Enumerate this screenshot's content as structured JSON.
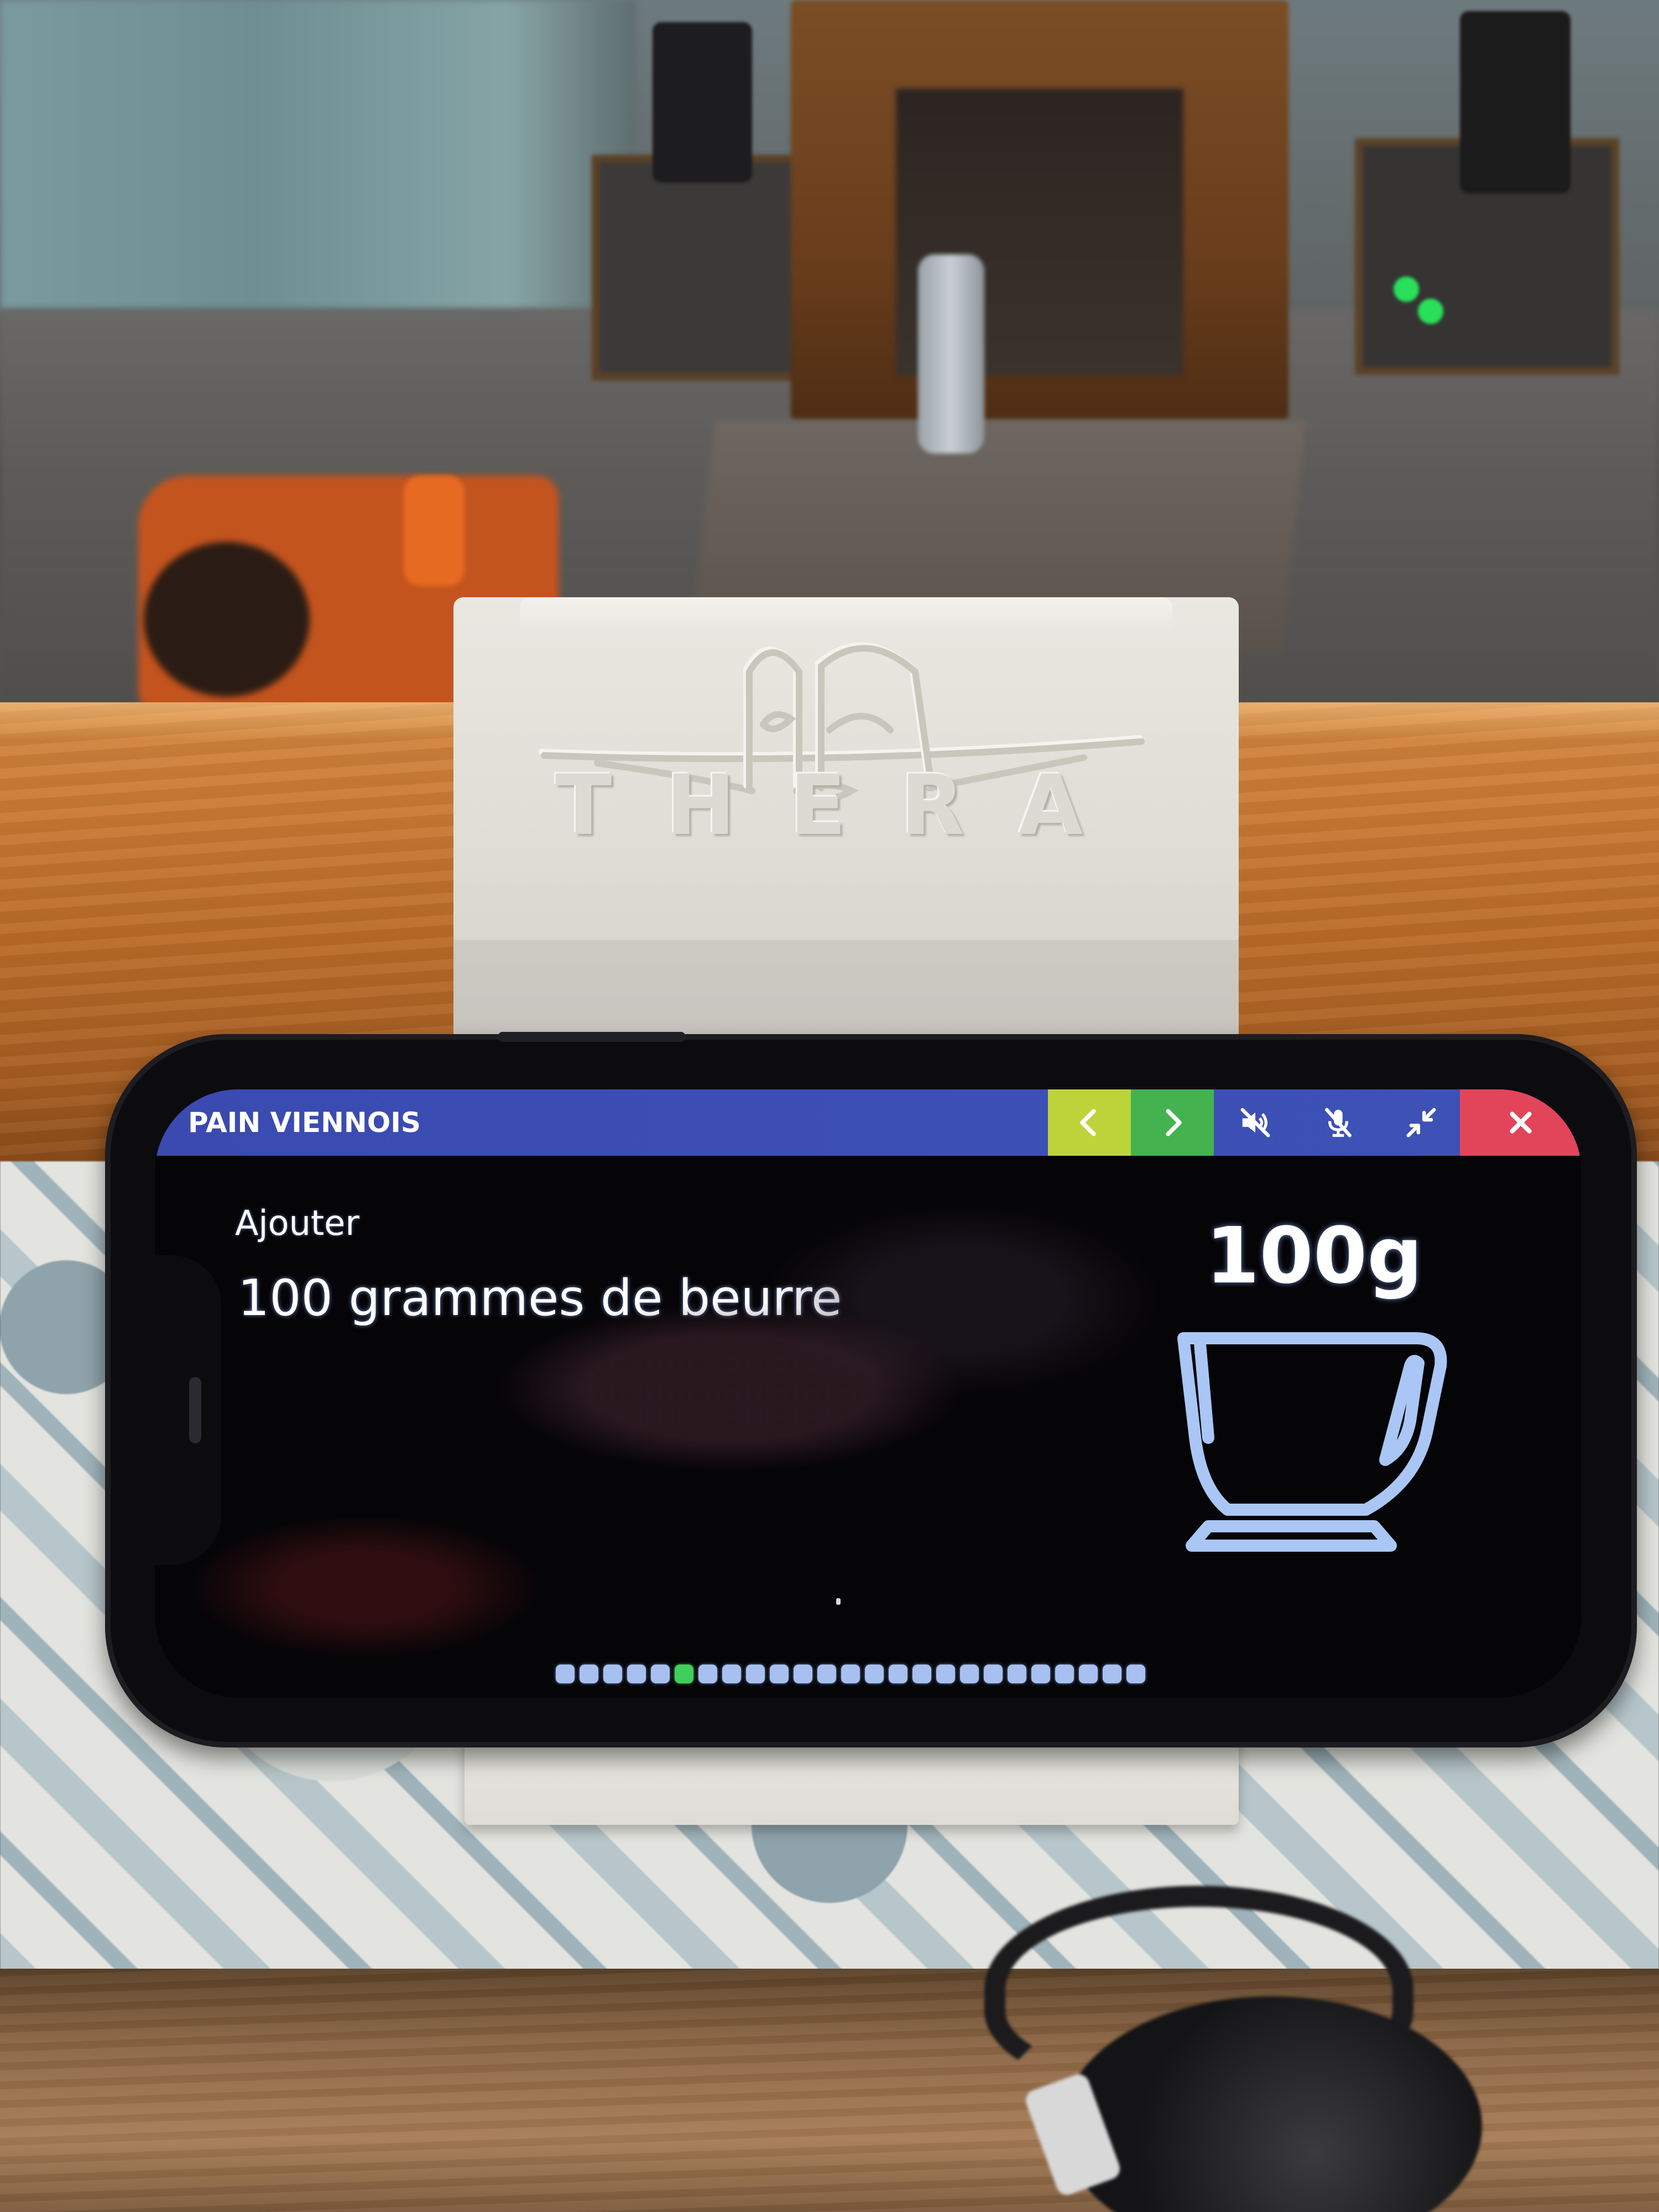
{
  "app": {
    "recipe_title": "PAIN VIENNOIS"
  },
  "toolbar": {
    "buttons": [
      {
        "icon": "chevron-left-icon",
        "color": "#bcd43a"
      },
      {
        "icon": "chevron-right-icon",
        "color": "#44b34f"
      },
      {
        "icon": "speaker-muted-icon"
      },
      {
        "icon": "microphone-muted-icon"
      },
      {
        "icon": "shrink-icon"
      },
      {
        "icon": "close-icon",
        "color": "#e2455a"
      }
    ],
    "bar_color": "#3c4fb5"
  },
  "step": {
    "action_label": "Ajouter",
    "instruction": "100 grammes de beurre",
    "quantity": "100g",
    "illustration_icon": "cup-icon"
  },
  "progress": {
    "total_steps": 25,
    "current_step": 6,
    "inactive_color": "#a7c0ef",
    "active_color": "#3fcf5c"
  },
  "stand": {
    "brand_text": "THERA"
  }
}
